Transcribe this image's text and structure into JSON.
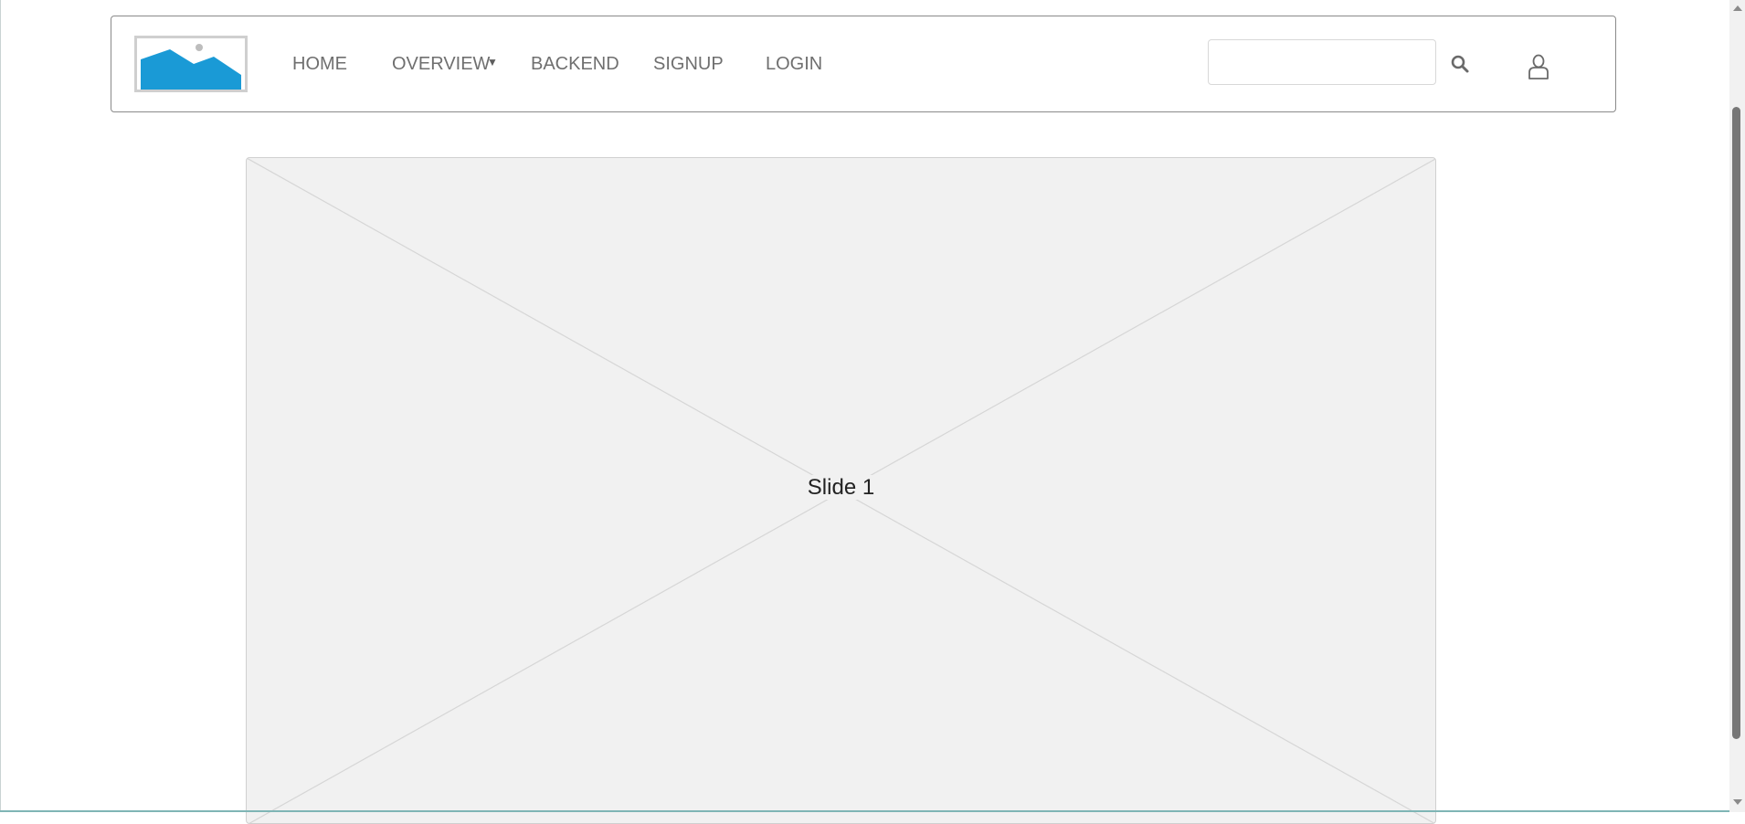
{
  "nav": {
    "items": [
      {
        "label": "HOME"
      },
      {
        "label": "OVERVIEW"
      },
      {
        "label": "BACKEND"
      },
      {
        "label": "SIGNUP"
      },
      {
        "label": "LOGIN"
      }
    ],
    "overview_caret": "▼"
  },
  "search": {
    "placeholder": "",
    "value": ""
  },
  "icons": {
    "logo": "image-placeholder-icon",
    "search": "search-icon",
    "user": "user-icon"
  },
  "carousel": {
    "slide_label": "Slide 1"
  },
  "colors": {
    "logo_blue": "#1a9ad6",
    "nav_text": "#6f6f6f",
    "slide_bg": "#f1f1f1"
  }
}
